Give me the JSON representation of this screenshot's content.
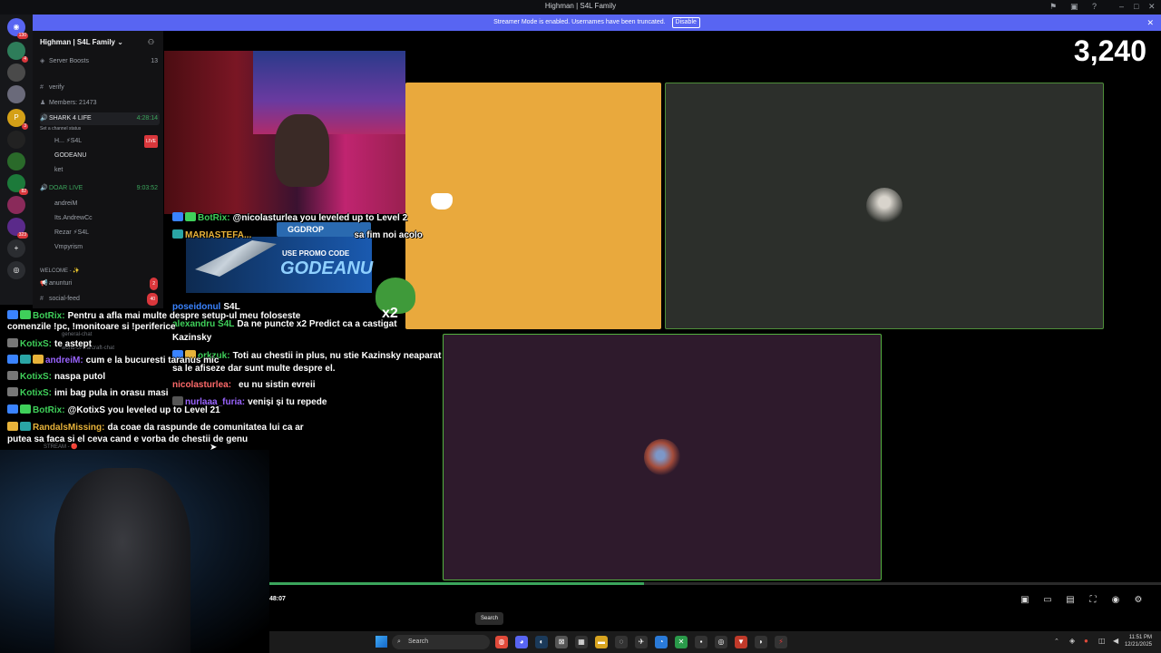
{
  "window": {
    "title": "Highman | S4L Family"
  },
  "banner": {
    "text": "Streamer Mode is enabled. Usernames have been truncated.",
    "disable_label": "Disable"
  },
  "rail": {
    "badges": [
      "130",
      "4",
      "3",
      "82",
      "323"
    ]
  },
  "sidebar": {
    "guild_name": "Highman | S4L Family",
    "server_boosts": {
      "label": "Server Boosts",
      "count": "13"
    },
    "verify": "verify",
    "members": "Members: 21473",
    "voice_1": {
      "name": "SHARK 4 LIFE",
      "status": "Set a channel status",
      "timer": "4:28:14"
    },
    "voice_1_users": [
      {
        "name": "H... ⚡S4L",
        "live": "LIVE"
      },
      {
        "name": "GODEANU"
      },
      {
        "name": "ket"
      }
    ],
    "voice_2": {
      "name": "DOAR LIVE",
      "timer": "9:03:52"
    },
    "voice_2_users": [
      "andreiM",
      "Its.AndrewCc",
      "Rezar ⚡S4L",
      "Vmpyrism"
    ],
    "category_welcome": "WELCOME - ✨",
    "channels": [
      {
        "name": "anunturi",
        "count": "2"
      },
      {
        "name": "social-feed",
        "count": "40"
      },
      {
        "name": "general-chat"
      },
      {
        "name": "world-of-warcraft-chat"
      }
    ],
    "category_stream": "STREAM - 🔴"
  },
  "viewer_count": "3,240",
  "promo": {
    "brand": "GGDROP",
    "label": "USE PROMO CODE",
    "code": "GODEANU"
  },
  "chat_overlay_mid": [
    {
      "name": "BotRix:",
      "text": "@nicolasturlea you leveled up to Level 2"
    },
    {
      "name": "MARIASTEFA...",
      "text": "sa fim noi acolo"
    },
    {
      "name": "poseidonul",
      "text": "S4L"
    },
    {
      "name": "alexandru S4L",
      "text": "Da ne puncte x2 Predict ca a castigat"
    },
    {
      "name": "",
      "text": "Kazinsky"
    },
    {
      "name": "orkzuk:",
      "text": "Toti au chestii in plus, nu stie Kazinsky neaparat"
    },
    {
      "name": "",
      "text": "sa le afiseze dar sunt multe despre el."
    },
    {
      "name": "nicolasturlea:",
      "text": "eu nu sistin evreii"
    },
    {
      "name": "nurlaaa_furia:",
      "text": "veniși și tu repede"
    }
  ],
  "chat_overlay_left": [
    {
      "name": "BotRix:",
      "text": "Pentru a afla mai multe despre setup-ul meu foloseste"
    },
    {
      "name": "",
      "text": "comenzile !pc, !monitoare si !periferice"
    },
    {
      "name": "KotixS:",
      "text": "te astept"
    },
    {
      "name": "andreiM:",
      "text": "cum e la bucuresti taranus mic"
    },
    {
      "name": "KotixS:",
      "text": "naspa putol"
    },
    {
      "name": "KotixS:",
      "text": "imi bag pula in orasu masi"
    },
    {
      "name": "BotRix:",
      "text": "@KotixS you leveled up to Level 21"
    },
    {
      "name": "RandalsMissing:",
      "text": "da coae da raspunde de comunitatea lui ca ar"
    },
    {
      "name": "",
      "text": "putea sa faca si el ceva cand e vorba de chestii de genu"
    }
  ],
  "player": {
    "time": "48:07",
    "progress": 0.42
  },
  "tooltip": "Search",
  "taskbar": {
    "search_label": "Search",
    "time": "11:51 PM",
    "date": "12/21/2025"
  }
}
